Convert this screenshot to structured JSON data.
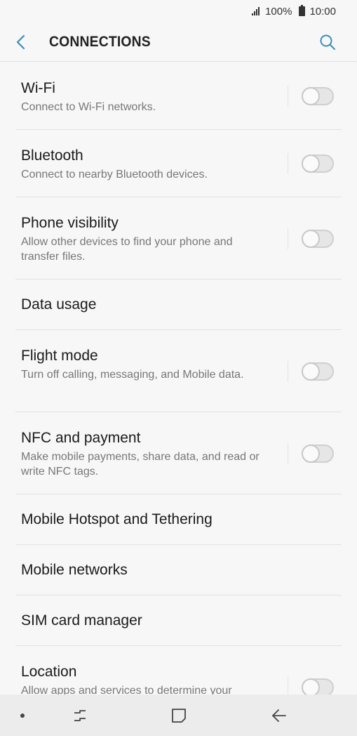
{
  "status_bar": {
    "battery": "100%",
    "time": "10:00"
  },
  "header": {
    "title": "CONNECTIONS"
  },
  "items": [
    {
      "title": "Wi-Fi",
      "desc": "Connect to Wi-Fi networks.",
      "toggle": false
    },
    {
      "title": "Bluetooth",
      "desc": "Connect to nearby Bluetooth devices.",
      "toggle": false
    },
    {
      "title": "Phone visibility",
      "desc": "Allow other devices to find your phone and transfer files.",
      "toggle": false
    },
    {
      "title": "Data usage"
    },
    {
      "title": "Flight mode",
      "desc": "Turn off calling, messaging, and Mobile data.",
      "toggle": false
    },
    {
      "title": "NFC and payment",
      "desc": "Make mobile payments, share data, and read or write NFC tags.",
      "toggle": false
    },
    {
      "title": "Mobile Hotspot and Tethering"
    },
    {
      "title": "Mobile networks"
    },
    {
      "title": "SIM card manager"
    },
    {
      "title": "Location",
      "desc": "Allow apps and services to determine your",
      "toggle": false
    }
  ],
  "icons": {
    "back": "back-arrow-icon",
    "search": "search-icon",
    "recent": "recent-apps-icon",
    "home": "home-icon",
    "nav_back": "back-icon"
  },
  "colors": {
    "accent": "#3a8fb7",
    "background": "#f7f7f7",
    "nav_bar": "#ececec"
  }
}
